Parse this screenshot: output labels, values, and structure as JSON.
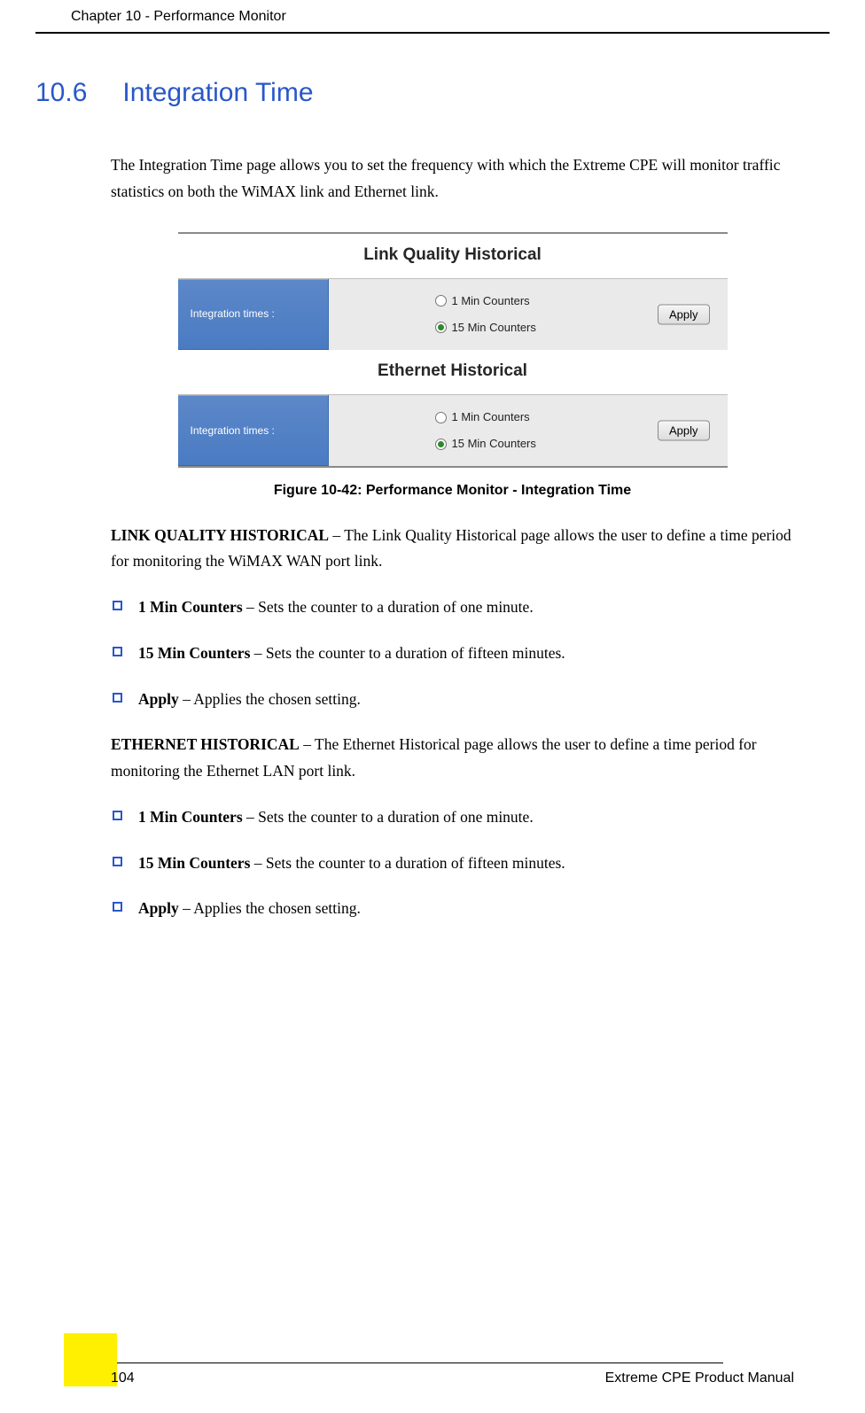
{
  "header": {
    "chapter": "Chapter 10 - Performance Monitor"
  },
  "section": {
    "number": "10.6",
    "title": "Integration Time"
  },
  "intro": "The Integration Time page allows you to set the frequency with which the Extreme CPE will monitor traffic statistics on both the WiMAX link and Ethernet link.",
  "figure": {
    "link_quality_title": "Link Quality Historical",
    "ethernet_title": "Ethernet Historical",
    "row_label": "Integration times :",
    "opt1": "1 Min Counters",
    "opt2": "15 Min Counters",
    "apply": "Apply",
    "caption": "Figure 10-42: Performance Monitor - Integration Time"
  },
  "link_quality": {
    "heading": "LINK QUALITY HISTORICAL",
    "desc": " – The Link Quality Historical page allows the user to define a time period for monitoring the WiMAX WAN port link.",
    "bullets": [
      {
        "label": "1 Min Counters",
        "desc": " – Sets the counter to a duration of one minute."
      },
      {
        "label": "15 Min Counters",
        "desc": " – Sets the counter to a duration of fifteen minutes."
      },
      {
        "label": "Apply",
        "desc": " – Applies the chosen setting."
      }
    ]
  },
  "ethernet": {
    "heading": "ETHERNET HISTORICAL",
    "desc": " – The Ethernet Historical page allows the user to define a time period for monitoring the Ethernet LAN port link.",
    "bullets": [
      {
        "label": "1 Min Counters",
        "desc": " – Sets the counter to a duration of one minute."
      },
      {
        "label": "15 Min Counters",
        "desc": " – Sets the counter to a duration of fifteen minutes."
      },
      {
        "label": "Apply",
        "desc": " – Applies the chosen setting."
      }
    ]
  },
  "footer": {
    "page": "104",
    "manual": "Extreme CPE Product Manual"
  }
}
